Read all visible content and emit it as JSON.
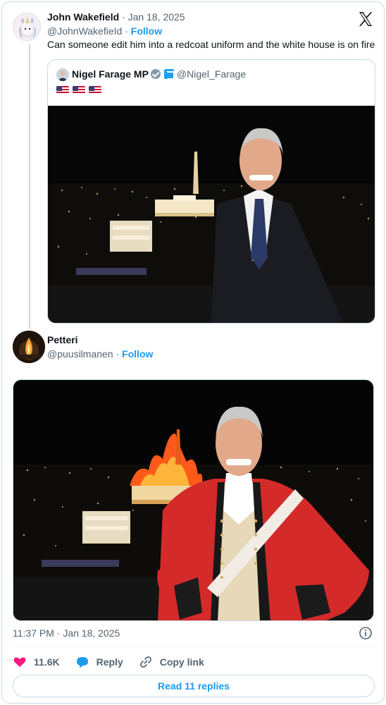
{
  "tweet1": {
    "display_name": "John Wakefield",
    "separator": "·",
    "date": "Jan 18, 2025",
    "handle": "@JohnWakefieId",
    "follow_label": "Follow",
    "text": "Can someone edit him into a redcoat uniform and the white house is on fire",
    "quoted": {
      "display_name": "Nigel Farage MP",
      "handle": "@Nigel_Farage",
      "flag_count": 3
    }
  },
  "tweet2": {
    "display_name": "Petteri",
    "handle": "@puusilmanen",
    "follow_label": "Follow",
    "timestamp": "11:37 PM · Jan 18, 2025",
    "actions": {
      "likes": "11.6K",
      "reply_label": "Reply",
      "copy_label": "Copy link"
    },
    "read_replies_label": "Read 11 replies"
  },
  "colors": {
    "accent": "#1d9bf0",
    "like": "#f91880",
    "text_muted": "#536471",
    "border": "#cfd9de"
  },
  "icons": [
    "x-logo-icon",
    "verified-badge-icon",
    "heart-icon",
    "reply-bubble-icon",
    "link-icon",
    "info-icon"
  ]
}
